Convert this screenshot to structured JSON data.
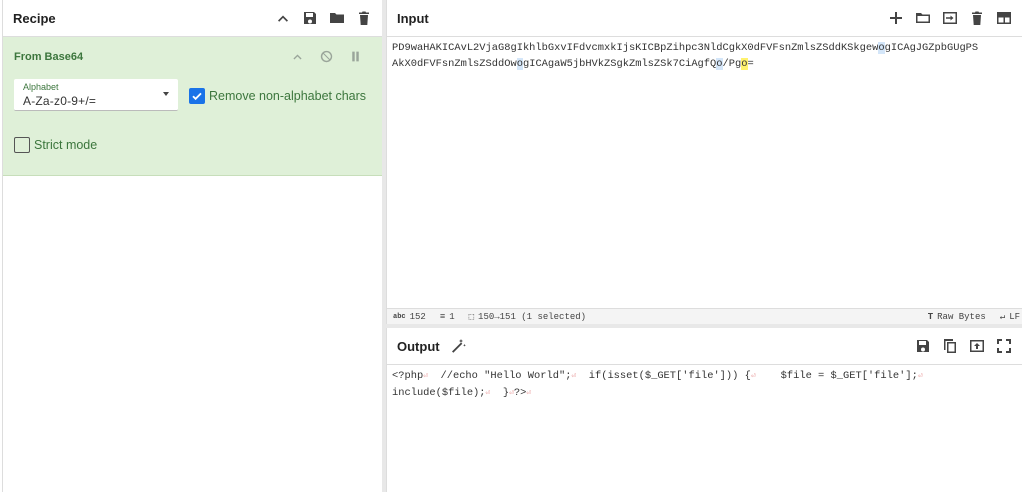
{
  "recipe": {
    "title": "Recipe",
    "icons": [
      "chevron-up-icon",
      "save-icon",
      "folder-icon",
      "trash-icon"
    ],
    "operation": {
      "name": "From Base64",
      "alphabet_label": "Alphabet",
      "alphabet_value": "A-Za-z0-9+/=",
      "remove_label": "Remove non-alphabet chars",
      "remove_checked": true,
      "strict_label": "Strict mode",
      "strict_checked": false
    }
  },
  "input": {
    "title": "Input",
    "icons": [
      "plus-icon",
      "folder-icon",
      "import-icon",
      "trash-icon",
      "layout-icon"
    ],
    "line1_a": "PD9waHAKICAvL2VjaG8gIkhlbGxvIFdvcmxkIjsKICBpZihpc3NldCgkX0dFVFsnZmlsZSddKSkgew",
    "line1_hl": "o",
    "line1_b": "gICAgJGZpbGUgPS",
    "line2_a": "AkX0dFVFsnZmlsZSddOw",
    "line2_hl1": "o",
    "line2_b": "gICAgaW5jbHVkZSgkZmlsZSk7CiAgfQ",
    "line2_hl2": "o",
    "line2_c": "/Pg",
    "line2_hl3": "o",
    "line2_d": "=",
    "status": {
      "length": "152",
      "lines": "1",
      "selection": "150→151 (1 selected)",
      "encoding": "Raw Bytes",
      "eol": "LF"
    }
  },
  "output": {
    "title": "Output",
    "icons": [
      "save-icon",
      "copy-icon",
      "replace-input-icon",
      "fullscreen-icon"
    ],
    "line1": [
      "<?php",
      "  //echo \"Hello World\";",
      "  if(isset($_GET['file'])) {",
      "    $file = $_GET['file'];"
    ],
    "line2": [
      "include($file);",
      "  }",
      "?>"
    ]
  }
}
